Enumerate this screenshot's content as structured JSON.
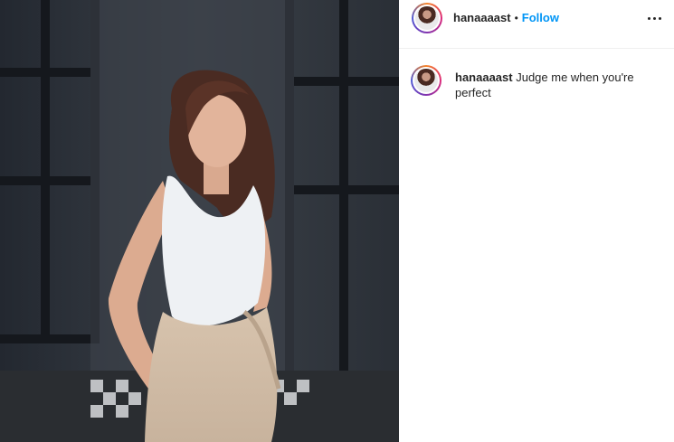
{
  "post": {
    "username": "hanaaaast",
    "separator": "•",
    "follow_label": "Follow",
    "more_icon": "more-options-icon",
    "caption": {
      "username": "hanaaaast",
      "text": "Judge me when you're perfect"
    }
  },
  "colors": {
    "follow": "#0095f6",
    "text": "#262626"
  }
}
